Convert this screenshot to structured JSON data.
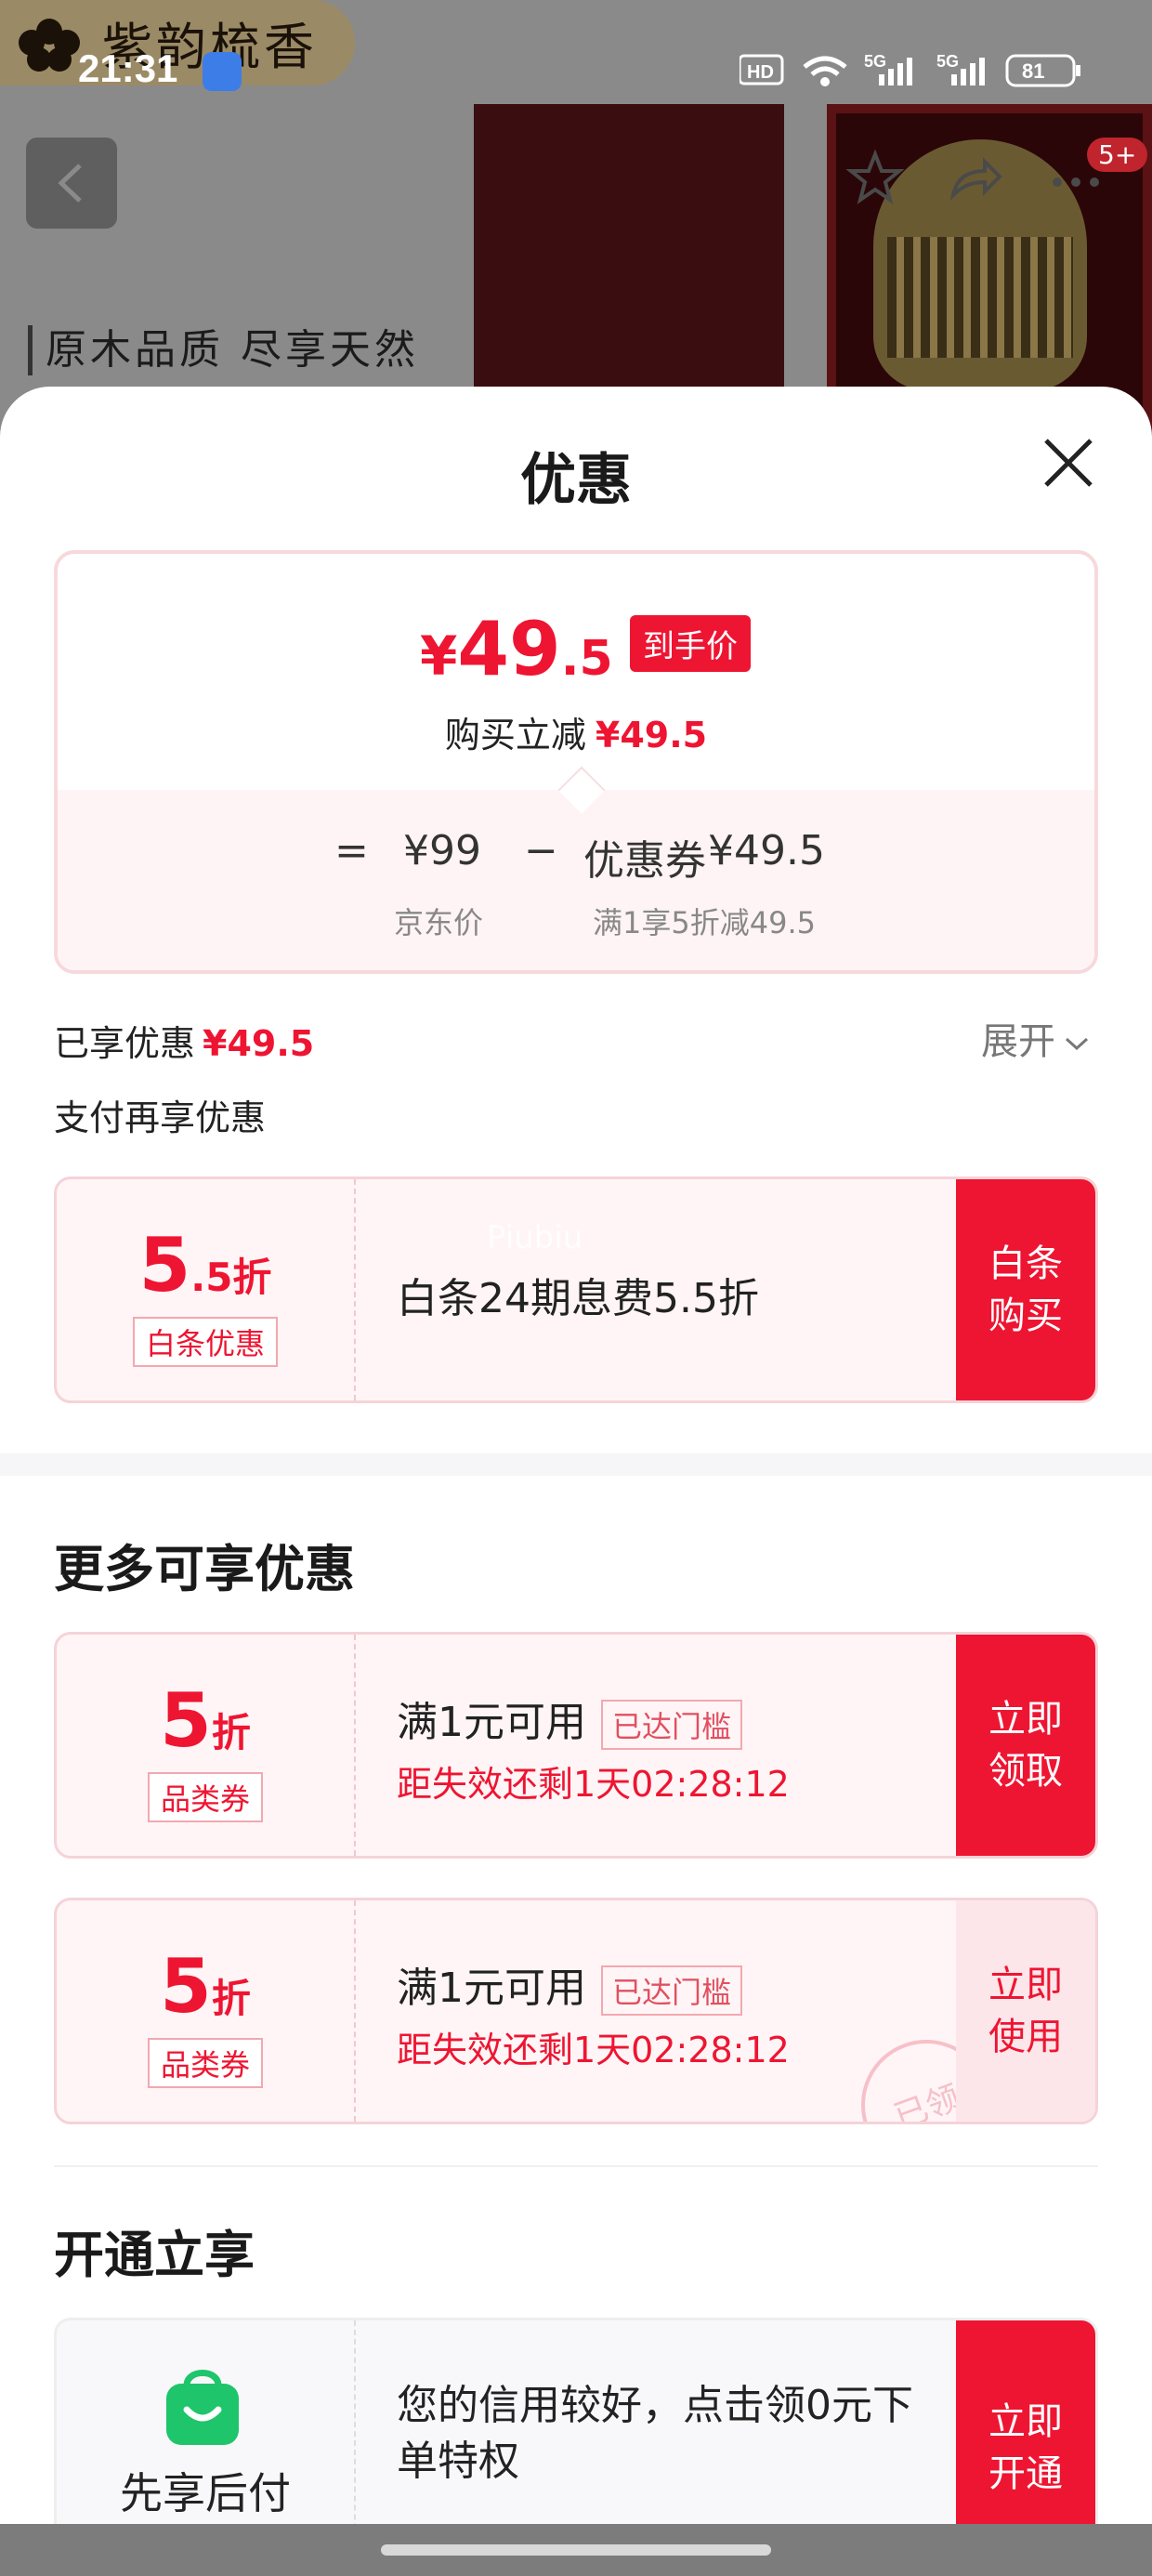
{
  "status_bar": {
    "time": "21:31",
    "network": "5G",
    "network2": "5G",
    "battery": "81"
  },
  "background": {
    "shop_name": "紫韵梳香",
    "tagline": "原木品质 尽享天然",
    "cart_badge": "5+"
  },
  "sheet": {
    "title": "优惠"
  },
  "price_card": {
    "yen": "¥",
    "price_int": "49",
    "price_dec": ".5",
    "final_tag": "到手价",
    "reduce_label": "购买立减",
    "reduce_amount": "¥49.5",
    "equals": "=",
    "base_price": "¥99",
    "minus": "−",
    "coupon_label": "优惠券",
    "coupon_amount": "¥49.5",
    "base_caption": "京东价",
    "coupon_caption": "满1享5折减49.5"
  },
  "enjoyed": {
    "label": "已享优惠",
    "amount": "¥49.5",
    "expand_label": "展开"
  },
  "pay_section": {
    "title": "支付再享优惠",
    "baitiao": {
      "disc_big": "5",
      "disc_small": ".5折",
      "chip": "白条优惠",
      "text": "白条24期息费5.5折",
      "action": "白条购买"
    }
  },
  "more_section": {
    "title": "更多可享优惠",
    "coupons": [
      {
        "disc_big": "5",
        "disc_small": "折",
        "chip": "品类券",
        "text": "满1元可用",
        "met": "已达门槛",
        "countdown": "距失效还剩1天02:28:12",
        "action": "立即领取"
      },
      {
        "disc_big": "5",
        "disc_small": "折",
        "chip": "品类券",
        "text": "满1元可用",
        "met": "已达门槛",
        "countdown": "距失效还剩1天02:28:12",
        "action": "立即使用",
        "stamp": "已领"
      }
    ]
  },
  "open_section": {
    "title": "开通立享",
    "service_name": "先享后付",
    "desc": "您的信用较好，点击领0元下单特权",
    "action": "立即开通"
  },
  "watermark": "Piubiu",
  "colors": {
    "accent": "#ee1532",
    "card_bg": "#fff5f6",
    "card_border": "#f5d3d8",
    "service_green": "#1fc56a"
  }
}
